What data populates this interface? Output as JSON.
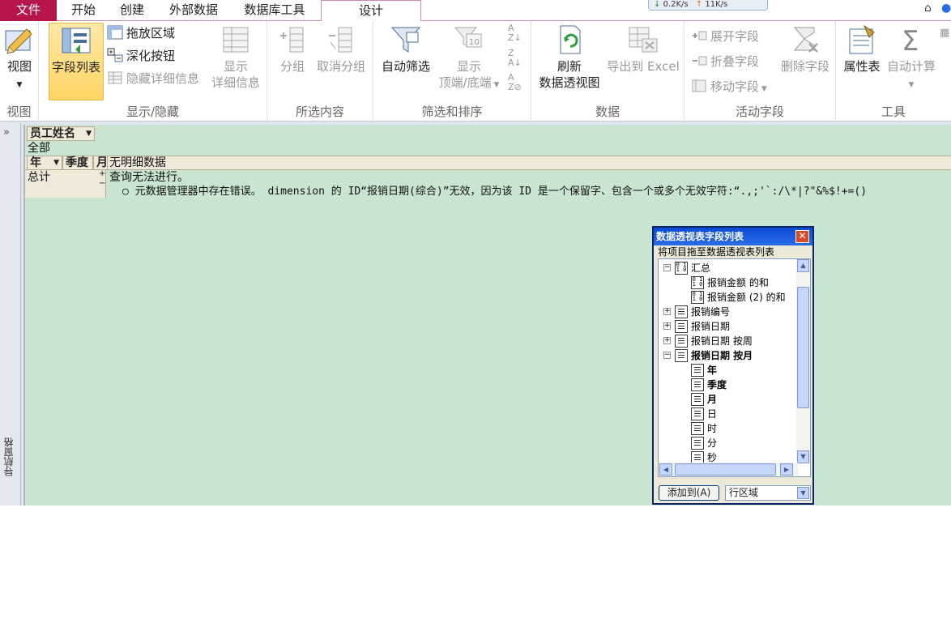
{
  "tabs": {
    "file": "文件",
    "home": "开始",
    "create": "创建",
    "external": "外部数据",
    "dbtools": "数据库工具",
    "design": "设计"
  },
  "netmon": {
    "down": "0.2K/s",
    "up": "11K/s"
  },
  "ribbon": {
    "view": {
      "label": "视图",
      "group": "视图"
    },
    "showhide": {
      "group": "显示/隐藏",
      "field_list": "字段列表",
      "drop_areas": "拖放区域",
      "drill_buttons": "深化按钮",
      "hide_details": "隐藏详细信息",
      "show_details_1": "显示",
      "show_details_2": "详细信息"
    },
    "selection": {
      "group": "所选内容",
      "group_btn": "分组",
      "ungroup": "取消分组"
    },
    "filter": {
      "group": "筛选和排序",
      "autofilter": "自动筛选",
      "show_top_1": "显示",
      "show_top_2": "顶端/底端"
    },
    "data": {
      "group": "数据",
      "refresh_1": "刷新",
      "refresh_2": "数据透视图",
      "export": "导出到 Excel"
    },
    "active_field": {
      "group": "活动字段",
      "expand": "展开字段",
      "collapse": "折叠字段",
      "move": "移动字段",
      "delete": "删除字段"
    },
    "tools": {
      "group": "工具",
      "property_sheet": "属性表",
      "autocalc": "自动计算"
    }
  },
  "navpane": {
    "label": "导航窗格"
  },
  "pivot": {
    "filter_field": "员工姓名",
    "filter_value": "全部",
    "row_fields": [
      "年",
      "季度",
      "月"
    ],
    "no_detail": "无明细数据",
    "grand_total": "总计",
    "error_title": "查询无法进行。",
    "error_detail": "○ 元数据管理器中存在错误。 dimension 的 ID“报销日期(综合)”无效，因为该 ID 是一个保留字、包含一个或多个无效字符:“.,;'`:/\\*|?\"&%$!+=()"
  },
  "fieldlist": {
    "title": "数据透视表字段列表",
    "hint": "将项目拖至数据透视表列表",
    "nodes": [
      {
        "text": "汇总",
        "type": "num",
        "level": 0,
        "exp": "−",
        "bold": false
      },
      {
        "text": "报销金额 的和",
        "type": "num",
        "level": 1,
        "exp": "",
        "bold": false
      },
      {
        "text": "报销金额 (2) 的和",
        "type": "num",
        "level": 1,
        "exp": "",
        "bold": false
      },
      {
        "text": "报销编号",
        "type": "list",
        "level": 0,
        "exp": "+",
        "bold": false
      },
      {
        "text": "报销日期",
        "type": "list",
        "level": 0,
        "exp": "+",
        "bold": false
      },
      {
        "text": "报销日期 按周",
        "type": "list",
        "level": 0,
        "exp": "+",
        "bold": false
      },
      {
        "text": "报销日期 按月",
        "type": "list",
        "level": 0,
        "exp": "−",
        "bold": true
      },
      {
        "text": "年",
        "type": "list",
        "level": 1,
        "exp": "",
        "bold": true
      },
      {
        "text": "季度",
        "type": "list",
        "level": 1,
        "exp": "",
        "bold": true
      },
      {
        "text": "月",
        "type": "list",
        "level": 1,
        "exp": "",
        "bold": true
      },
      {
        "text": "日",
        "type": "list",
        "level": 1,
        "exp": "",
        "bold": false
      },
      {
        "text": "时",
        "type": "list",
        "level": 1,
        "exp": "",
        "bold": false
      },
      {
        "text": "分",
        "type": "list",
        "level": 1,
        "exp": "",
        "bold": false
      },
      {
        "text": "秒",
        "type": "list",
        "level": 1,
        "exp": "",
        "bold": false
      }
    ],
    "add_button": "添加到(A)",
    "area_value": "行区域"
  }
}
